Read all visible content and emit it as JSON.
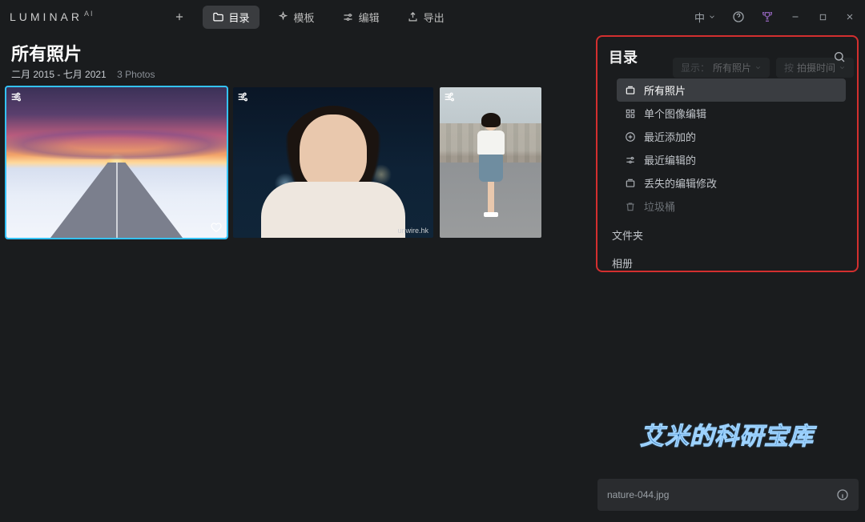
{
  "titlebar": {
    "logo_main": "LUMINAR",
    "logo_sup": "AI",
    "lang_label": "中"
  },
  "nav": {
    "add_tooltip": "添加",
    "catalog": "目录",
    "templates": "模板",
    "edit": "编辑",
    "export": "导出"
  },
  "header": {
    "title": "所有照片",
    "date_range": "二月 2015 - 七月 2021",
    "count_label": "3 Photos",
    "show_prefix": "显示：",
    "show_value": "所有照片",
    "sort_prefix": "按",
    "sort_value": "拍摄时间"
  },
  "sidebar": {
    "title": "目录",
    "items": [
      {
        "label": "所有照片",
        "icon": "stack",
        "active": true
      },
      {
        "label": "单个图像编辑",
        "icon": "grid",
        "active": false
      },
      {
        "label": "最近添加的",
        "icon": "plus-circle",
        "active": false
      },
      {
        "label": "最近编辑的",
        "icon": "sliders",
        "active": false
      },
      {
        "label": "丢失的编辑修改",
        "icon": "stack",
        "active": false
      },
      {
        "label": "垃圾桶",
        "icon": "trash",
        "active": false,
        "dim": true
      }
    ],
    "section_folders": "文件夹",
    "section_albums": "相册"
  },
  "thumbs": {
    "unwire_mark": "unwire.hk"
  },
  "watermark": "艾米的科研宝库",
  "filebar": {
    "filename": "nature-044.jpg"
  }
}
